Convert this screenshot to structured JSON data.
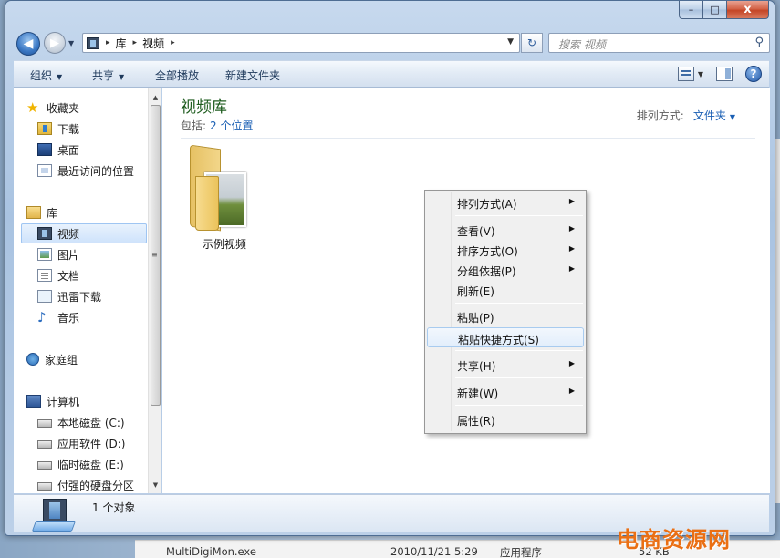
{
  "caption": {
    "min": "–",
    "max": "□",
    "close": "x"
  },
  "nav": {
    "back": "◀",
    "forward": "▶",
    "history": "▼"
  },
  "address": {
    "parts": [
      "库",
      "视频"
    ],
    "sep": "▸",
    "dropdown": "▼"
  },
  "refresh": "↻",
  "search": {
    "placeholder": "搜索 视频",
    "icon": "⚲"
  },
  "toolbar": {
    "organize": "组织",
    "share": "共享",
    "play_all": "全部播放",
    "new_folder": "新建文件夹",
    "dropdown_arrow": "▼",
    "view_arrow": "▼",
    "help": "?"
  },
  "sidebar": {
    "favorites": "收藏夹",
    "downloads": "下载",
    "desktop": "桌面",
    "recent": "最近访问的位置",
    "libraries": "库",
    "videos": "视频",
    "pictures": "图片",
    "documents": "文档",
    "xunlei": "迅雷下载",
    "music": "音乐",
    "homegroup": "家庭组",
    "computer": "计算机",
    "drive_c": "本地磁盘 (C:)",
    "drive_d": "应用软件 (D:)",
    "drive_e": "临时磁盘 (E:)",
    "partition": "付强的硬盘分区",
    "scroll_up": "▲",
    "scroll_down": "▼",
    "grip": "≡"
  },
  "library": {
    "title": "视频库",
    "includes_label": "包括:",
    "includes_link": "2 个位置",
    "arrange_label": "排列方式:",
    "arrange_value": "文件夹",
    "arrange_arrow": "▼"
  },
  "items": [
    {
      "label": "示例视频"
    }
  ],
  "context_menu": {
    "items": [
      {
        "label": "排列方式(A)",
        "submenu": "▶"
      },
      {
        "label": "查看(V)",
        "submenu": "▶"
      },
      {
        "label": "排序方式(O)",
        "submenu": "▶"
      },
      {
        "label": "分组依据(P)",
        "submenu": "▶"
      },
      {
        "label": "刷新(E)"
      },
      {
        "label": "粘贴(P)"
      },
      {
        "label": "粘贴快捷方式(S)"
      },
      {
        "label": "共享(H)",
        "submenu": "▶"
      },
      {
        "label": "新建(W)",
        "submenu": "▶"
      },
      {
        "label": "属性(R)"
      }
    ],
    "highlighted_index": 6
  },
  "details": {
    "count": "1 个对象"
  },
  "background_row": {
    "name": "MultiDigiMon.exe",
    "date": "2010/11/21 5:29",
    "type": "应用程序",
    "size": "52 KB"
  },
  "watermark": "电商资源网",
  "colors": {
    "title_green": "#1e5c1e",
    "link_blue": "#1a5fb4",
    "watermark": "#ea6f14"
  }
}
